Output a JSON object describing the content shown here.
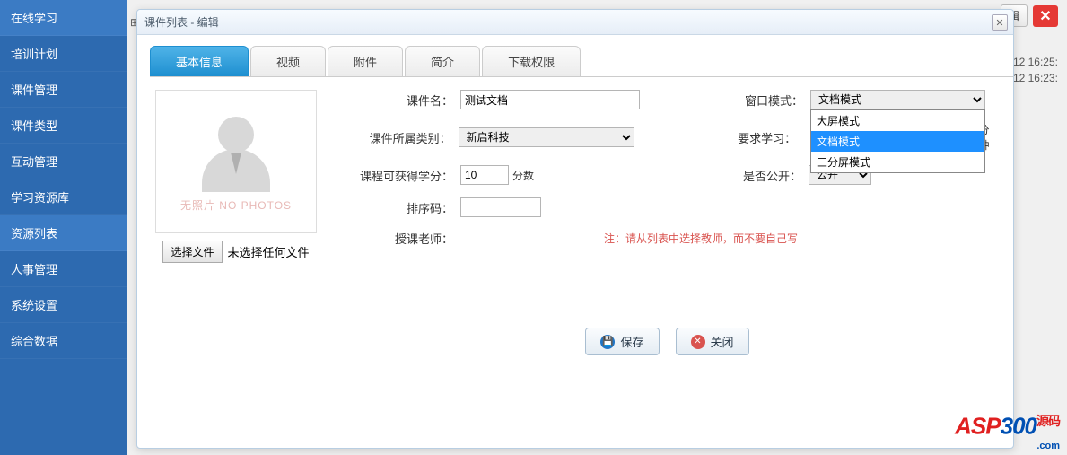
{
  "sidebar": {
    "items": [
      {
        "label": "在线学习"
      },
      {
        "label": "培训计划"
      },
      {
        "label": "课件管理"
      },
      {
        "label": "课件类型"
      },
      {
        "label": "互动管理"
      },
      {
        "label": "学习资源库"
      },
      {
        "label": "资源列表"
      },
      {
        "label": "人事管理"
      },
      {
        "label": "系统设置"
      },
      {
        "label": "综合数据"
      }
    ]
  },
  "bg_rows": [
    "/12 16:25:",
    "/12 16:23:"
  ],
  "top_edit": "辑",
  "dialog": {
    "title": "课件列表 - 编辑",
    "tabs": [
      "基本信息",
      "视频",
      "附件",
      "简介",
      "下载权限"
    ],
    "no_photo": "无照片 NO PHOTOS",
    "choose_file": "选择文件",
    "no_file": "未选择任何文件",
    "labels": {
      "name": "课件名：",
      "category": "课件所属类别：",
      "credits": "课程可获得学分：",
      "order": "排序码：",
      "teacher": "授课老师：",
      "window_mode": "窗口模式：",
      "required": "要求学习：",
      "public": "是否公开："
    },
    "values": {
      "name": "测试文档",
      "category": "新启科技",
      "credits": "10",
      "credits_unit": "分数",
      "order": "",
      "required_unit": "分钟",
      "window_mode": "文档模式",
      "public": "公开"
    },
    "dropdown_options": [
      "大屏模式",
      "文档模式",
      "三分屏模式"
    ],
    "teacher_note": "注：请从列表中选择教师，而不要自己写",
    "save": "保存",
    "close": "关闭"
  },
  "watermark": {
    "t1": "ASP",
    "t2": "300",
    "ym": "源码",
    "sub": ".com"
  }
}
